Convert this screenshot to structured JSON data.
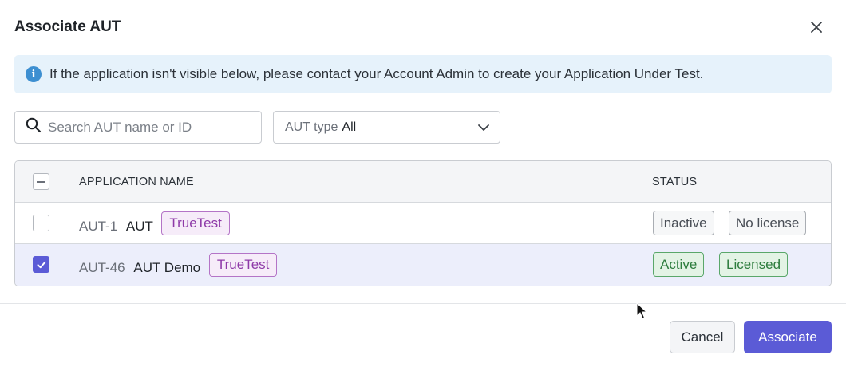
{
  "dialog": {
    "title": "Associate AUT",
    "close_icon": "close-icon"
  },
  "banner": {
    "icon": "info-icon",
    "icon_glyph": "i",
    "text": "If the application isn't visible below, please contact your Account Admin to create your Application Under Test."
  },
  "search": {
    "icon": "search-icon",
    "placeholder": "Search AUT name or ID",
    "value": ""
  },
  "filter": {
    "label": "AUT type",
    "value": "All",
    "icon": "chevron-down-icon"
  },
  "table": {
    "headers": {
      "name": "APPLICATION NAME",
      "status": "STATUS"
    },
    "select_all_state": "indeterminate",
    "rows": [
      {
        "id": "AUT-1",
        "name": "AUT",
        "tag": "TrueTest",
        "checked": false,
        "status": [
          "Inactive",
          "No license"
        ]
      },
      {
        "id": "AUT-46",
        "name": "AUT Demo",
        "tag": "TrueTest",
        "checked": true,
        "status": [
          "Active",
          "Licensed"
        ]
      }
    ]
  },
  "footer": {
    "cancel_label": "Cancel",
    "associate_label": "Associate"
  },
  "colors": {
    "primary": "#5b5bd6",
    "banner_bg": "#e6f2fb",
    "info": "#3d8fd1",
    "tag": "#8e3aa8",
    "success": "#2e7d3e"
  }
}
